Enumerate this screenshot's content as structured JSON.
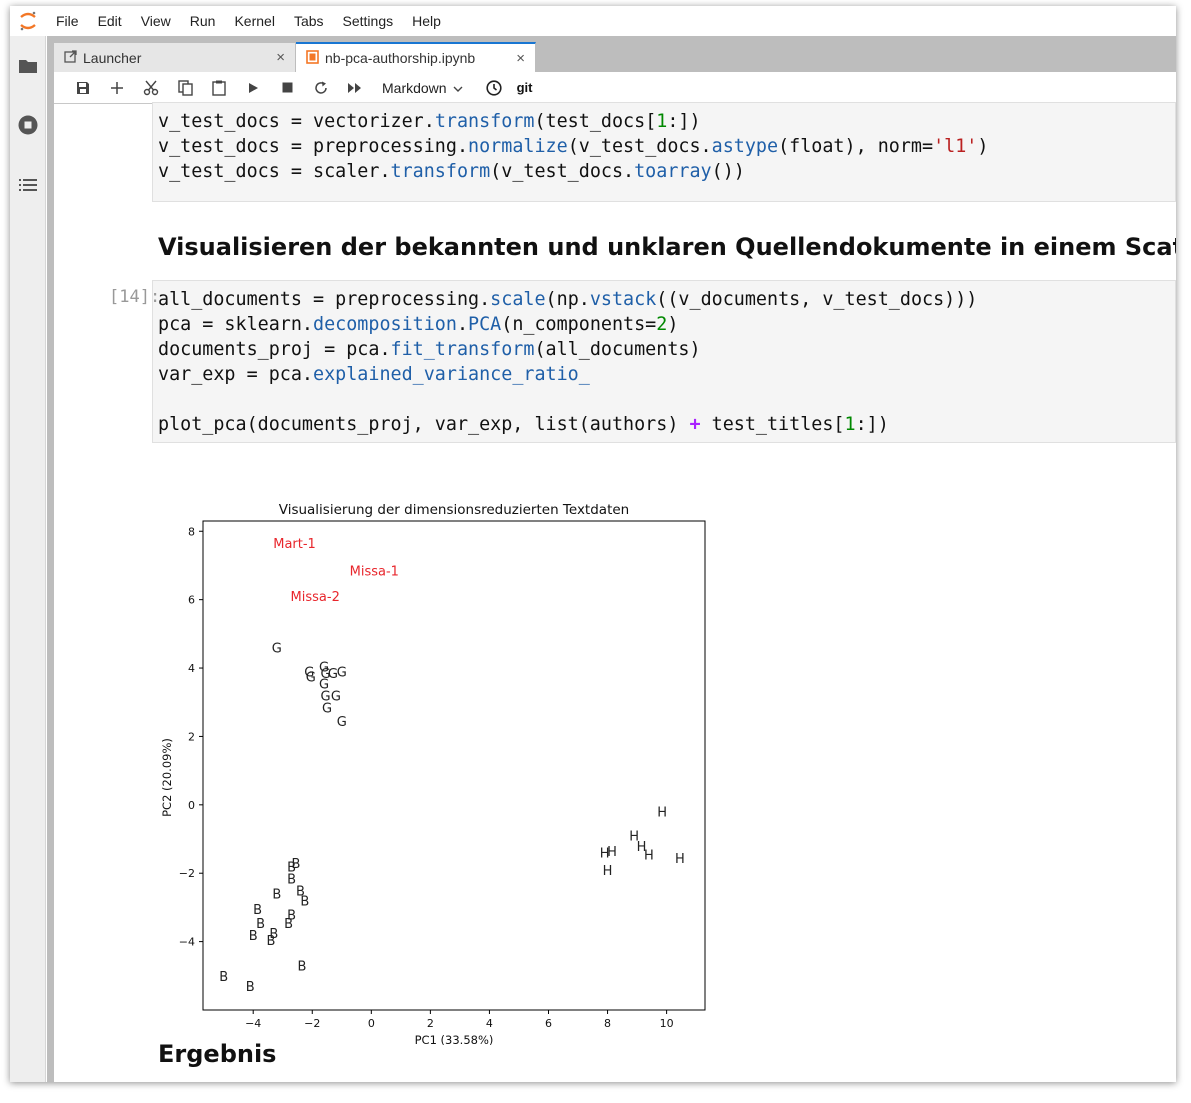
{
  "menu": [
    "File",
    "Edit",
    "View",
    "Run",
    "Kernel",
    "Tabs",
    "Settings",
    "Help"
  ],
  "tabs": [
    {
      "label": "Launcher",
      "close": "×"
    },
    {
      "label": "nb-pca-authorship.ipynb",
      "close": "×"
    }
  ],
  "toolbar": {
    "cell_type": "Markdown",
    "git": "git"
  },
  "cells": {
    "cell1": {
      "lines": [
        "v_test_docs = vectorizer.transform(test_docs[1:])",
        "v_test_docs = preprocessing.normalize(v_test_docs.astype(float), norm='l1')",
        "v_test_docs = scaler.transform(v_test_docs.toarray())"
      ]
    },
    "heading1": "Visualisieren der bekannten und unklaren Quellendokumente in einem Scatterplot",
    "cell2": {
      "prompt": "[14]:",
      "lines": [
        "all_documents = preprocessing.scale(np.vstack((v_documents, v_test_docs)))",
        "pca = sklearn.decomposition.PCA(n_components=2)",
        "documents_proj = pca.fit_transform(all_documents)",
        "var_exp = pca.explained_variance_ratio_",
        "",
        "plot_pca(documents_proj, var_exp, list(authors) + test_titles[1:])"
      ]
    },
    "heading2": "Ergebnis"
  },
  "chart_data": {
    "type": "scatter",
    "title": "Visualisierung der dimensionsreduzierten Textdaten",
    "xlabel": "PC1 (33.58%)",
    "ylabel": "PC2 (20.09%)",
    "xlim": [
      -5.7,
      11.3
    ],
    "ylim": [
      -6.0,
      8.3
    ],
    "xticks": [
      -4,
      -2,
      0,
      2,
      4,
      6,
      8,
      10
    ],
    "yticks": [
      -4,
      -2,
      0,
      2,
      4,
      6,
      8
    ],
    "xtick_labels": [
      "−4",
      "−2",
      "0",
      "2",
      "4",
      "6",
      "8",
      "10"
    ],
    "ytick_labels": [
      "−4",
      "−2",
      "0",
      "2",
      "4",
      "6",
      "8"
    ],
    "grid": false,
    "series": [
      {
        "label": "G",
        "color": "#222222",
        "points": [
          [
            -3.2,
            4.6
          ],
          [
            -2.1,
            3.9
          ],
          [
            -2.05,
            3.75
          ],
          [
            -1.6,
            4.05
          ],
          [
            -1.55,
            3.85
          ],
          [
            -1.3,
            3.85
          ],
          [
            -1.0,
            3.9
          ],
          [
            -1.6,
            3.55
          ],
          [
            -1.55,
            3.2
          ],
          [
            -1.2,
            3.2
          ],
          [
            -1.5,
            2.85
          ],
          [
            -1.0,
            2.45
          ]
        ]
      },
      {
        "label": "B",
        "color": "#222222",
        "points": [
          [
            -5.0,
            -5.0
          ],
          [
            -4.1,
            -5.3
          ],
          [
            -4.0,
            -3.8
          ],
          [
            -3.85,
            -3.05
          ],
          [
            -3.75,
            -3.45
          ],
          [
            -3.4,
            -3.95
          ],
          [
            -3.3,
            -3.75
          ],
          [
            -3.2,
            -2.6
          ],
          [
            -2.7,
            -1.8
          ],
          [
            -2.55,
            -1.7
          ],
          [
            -2.7,
            -2.15
          ],
          [
            -2.4,
            -2.5
          ],
          [
            -2.25,
            -2.8
          ],
          [
            -2.7,
            -3.2
          ],
          [
            -2.8,
            -3.45
          ],
          [
            -2.35,
            -4.7
          ]
        ]
      },
      {
        "label": "H",
        "color": "#222222",
        "points": [
          [
            7.9,
            -1.4
          ],
          [
            8.15,
            -1.35
          ],
          [
            8.0,
            -1.9
          ],
          [
            8.9,
            -0.9
          ],
          [
            9.15,
            -1.2
          ],
          [
            9.4,
            -1.45
          ],
          [
            9.85,
            -0.2
          ],
          [
            10.45,
            -1.55
          ]
        ]
      }
    ],
    "annotations": [
      {
        "text": "Mart-1",
        "x": -2.6,
        "y": 7.65,
        "color": "#e8262c"
      },
      {
        "text": "Missa-1",
        "x": 0.1,
        "y": 6.85,
        "color": "#e8262c"
      },
      {
        "text": "Missa-2",
        "x": -1.9,
        "y": 6.1,
        "color": "#e8262c"
      }
    ]
  }
}
